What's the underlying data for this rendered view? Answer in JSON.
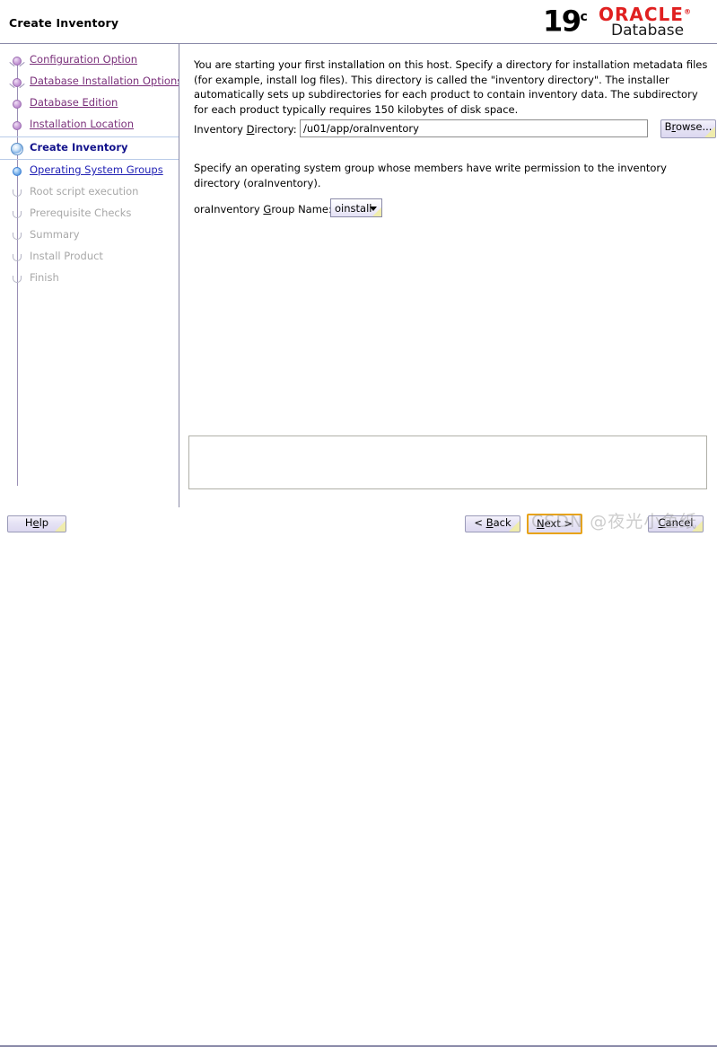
{
  "header": {
    "title": "Create Inventory",
    "brand": {
      "version": "19",
      "version_sup": "c",
      "oracle": "ORACLE",
      "registered": "®",
      "product": "Database"
    }
  },
  "sidebar": {
    "items": [
      {
        "label": "Configuration Option",
        "state": "done"
      },
      {
        "label": "Database Installation Options",
        "state": "done"
      },
      {
        "label": "Database Edition",
        "state": "done"
      },
      {
        "label": "Installation Location",
        "state": "done"
      },
      {
        "label": "Create Inventory",
        "state": "active"
      },
      {
        "label": "Operating System Groups",
        "state": "next"
      },
      {
        "label": "Root script execution",
        "state": "disabled"
      },
      {
        "label": "Prerequisite Checks",
        "state": "disabled"
      },
      {
        "label": "Summary",
        "state": "disabled"
      },
      {
        "label": "Install Product",
        "state": "disabled"
      },
      {
        "label": "Finish",
        "state": "disabled"
      }
    ]
  },
  "main": {
    "intro": "You are starting your first installation on this host. Specify a directory for installation metadata files (for example, install log files). This directory is called the \"inventory directory\". The installer automatically sets up subdirectories for each product to contain inventory data. The subdirectory for each product typically requires 150 kilobytes of disk space.",
    "inventory_directory": {
      "label_pre": "Inventory ",
      "label_mnemonic": "D",
      "label_post": "irectory:",
      "value": "/u01/app/oraInventory",
      "placeholder": ""
    },
    "browse_button": {
      "pre": "B",
      "mnemonic": "r",
      "post": "owse..."
    },
    "group_text": "Specify an operating system group whose members have write permission to the inventory directory (oraInventory).",
    "group_name": {
      "label_pre": "oraInventory ",
      "label_mnemonic": "G",
      "label_post": "roup Name:",
      "selected": "oinstall",
      "options": [
        "oinstall"
      ]
    },
    "message_panel": ""
  },
  "footer": {
    "help": {
      "pre": "H",
      "mnemonic": "e",
      "post": "lp"
    },
    "back": {
      "pre": "< ",
      "mnemonic": "B",
      "post": "ack"
    },
    "next": {
      "pre": "",
      "mnemonic": "N",
      "post": "ext >"
    },
    "cancel": {
      "pre": "",
      "mnemonic": "C",
      "post": "ancel"
    }
  },
  "watermark": {
    "text": "CSDN @夜光小鱼纸"
  },
  "colors": {
    "accent_focus": "#e8a317",
    "oracle_red": "#e02020",
    "done_link": "#7a2f7a",
    "next_link": "#2222b5",
    "active_text": "#13138c",
    "disabled_text": "#a8a8a8",
    "divider": "#8a8aa8"
  }
}
